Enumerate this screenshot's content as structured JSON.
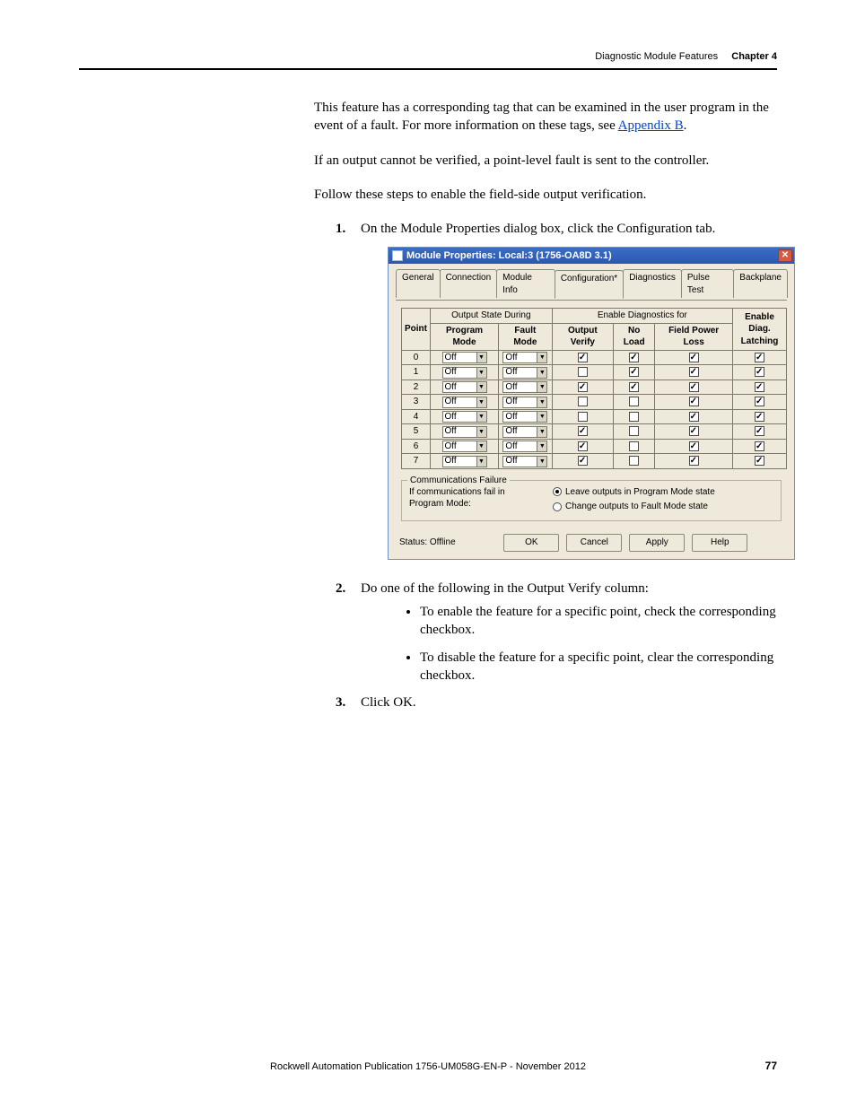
{
  "header": {
    "section": "Diagnostic Module Features",
    "chapter": "Chapter 4"
  },
  "paragraphs": {
    "p1a": "This feature has a corresponding tag that can be examined in the user program in the event of a fault. For more information on these tags, see ",
    "p1link": "Appendix B",
    "p1b": ".",
    "p2": "If an output cannot be verified, a point-level fault is sent to the controller.",
    "p3": "Follow these steps to enable the field-side output verification."
  },
  "steps": {
    "s1num": "1.",
    "s1": "On the Module Properties dialog box, click the Configuration tab.",
    "s2num": "2.",
    "s2": "Do one of the following in the Output Verify column:",
    "s2b1": "To enable the feature for a specific point, check the corresponding checkbox.",
    "s2b2": "To disable the feature for a specific point, clear the corresponding checkbox.",
    "s3num": "3.",
    "s3": "Click OK."
  },
  "dialog": {
    "title": "Module Properties: Local:3 (1756-OA8D 3.1)",
    "tabs": [
      "General",
      "Connection",
      "Module Info",
      "Configuration*",
      "Diagnostics",
      "Pulse Test",
      "Backplane"
    ],
    "active_tab": 3,
    "headers": {
      "point": "Point",
      "output_state": "Output State During",
      "enable_diag": "Enable Diagnostics for",
      "enable_latch": "Enable Diag. Latching",
      "program_mode": "Program Mode",
      "fault_mode": "Fault Mode",
      "output_verify": "Output Verify",
      "no_load": "No Load",
      "field_power": "Field Power Loss"
    },
    "rows": [
      {
        "pt": "0",
        "pm": "Off",
        "fm": "Off",
        "ov": true,
        "nl": true,
        "fp": true,
        "lt": true
      },
      {
        "pt": "1",
        "pm": "Off",
        "fm": "Off",
        "ov": false,
        "nl": true,
        "fp": true,
        "lt": true
      },
      {
        "pt": "2",
        "pm": "Off",
        "fm": "Off",
        "ov": true,
        "nl": true,
        "fp": true,
        "lt": true
      },
      {
        "pt": "3",
        "pm": "Off",
        "fm": "Off",
        "ov": false,
        "nl": false,
        "fp": true,
        "lt": true
      },
      {
        "pt": "4",
        "pm": "Off",
        "fm": "Off",
        "ov": false,
        "nl": false,
        "fp": true,
        "lt": true
      },
      {
        "pt": "5",
        "pm": "Off",
        "fm": "Off",
        "ov": true,
        "nl": false,
        "fp": true,
        "lt": true
      },
      {
        "pt": "6",
        "pm": "Off",
        "fm": "Off",
        "ov": true,
        "nl": false,
        "fp": true,
        "lt": true
      },
      {
        "pt": "7",
        "pm": "Off",
        "fm": "Off",
        "ov": true,
        "nl": false,
        "fp": true,
        "lt": true
      }
    ],
    "comm": {
      "legend": "Communications Failure",
      "text": "If communications fail in Program Mode:",
      "opt1": "Leave outputs in Program Mode state",
      "opt2": "Change outputs to Fault Mode state",
      "selected": 0
    },
    "status": "Status:  Offline",
    "buttons": {
      "ok": "OK",
      "cancel": "Cancel",
      "apply": "Apply",
      "help": "Help"
    }
  },
  "footer": {
    "pub": "Rockwell Automation Publication 1756-UM058G-EN-P - November 2012",
    "page": "77"
  }
}
